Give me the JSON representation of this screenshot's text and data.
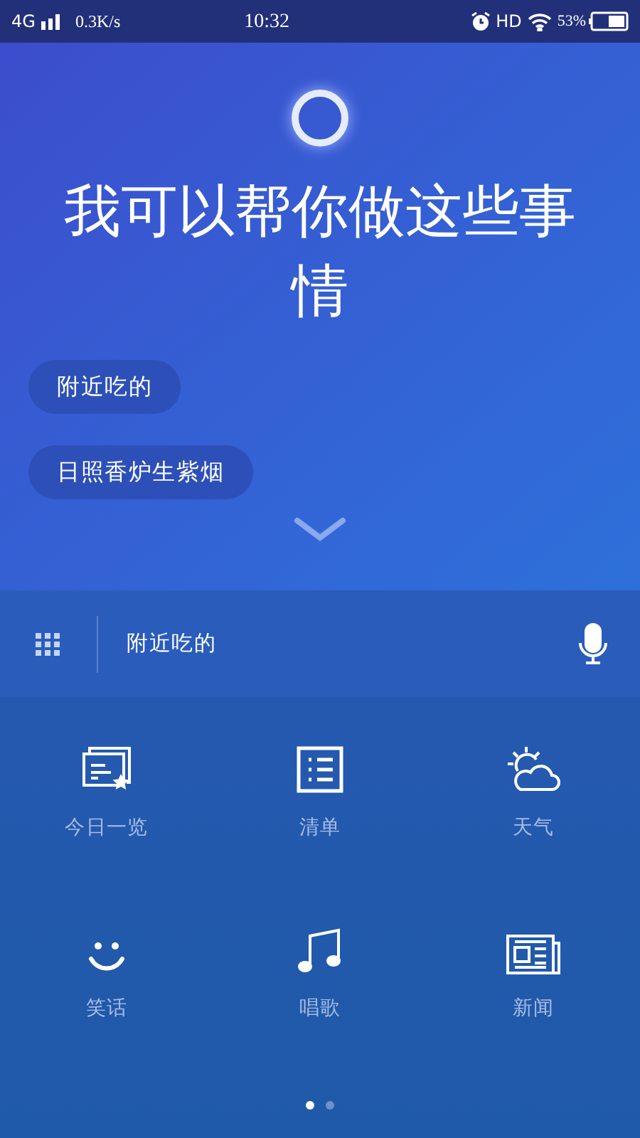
{
  "status_bar": {
    "network": "4G",
    "speed": "0.3K/s",
    "time": "10:32",
    "hd": "HD",
    "battery": "53%"
  },
  "title": "我可以帮你做这些事情",
  "suggestions": [
    "附近吃的",
    "日照香炉生紫烟"
  ],
  "input": {
    "value": "附近吃的"
  },
  "tiles": [
    {
      "kind": "overview",
      "label": "今日一览"
    },
    {
      "kind": "list",
      "label": "清单"
    },
    {
      "kind": "weather",
      "label": "天气"
    },
    {
      "kind": "joke",
      "label": "笑话"
    },
    {
      "kind": "music",
      "label": "唱歌"
    },
    {
      "kind": "news",
      "label": "新闻"
    }
  ],
  "pages": [
    {
      "selected": true
    },
    {
      "selected": false
    }
  ]
}
